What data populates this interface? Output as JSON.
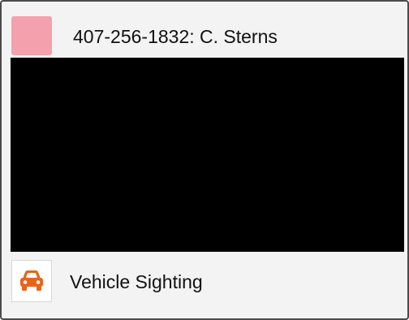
{
  "card": {
    "title": "407-256-1832: C. Sterns",
    "avatar_color": "#f4a1ad",
    "media": {
      "background": "#000000"
    },
    "event": {
      "icon": "car-icon",
      "icon_color": "#e8641b",
      "label": "Vehicle Sighting"
    }
  }
}
